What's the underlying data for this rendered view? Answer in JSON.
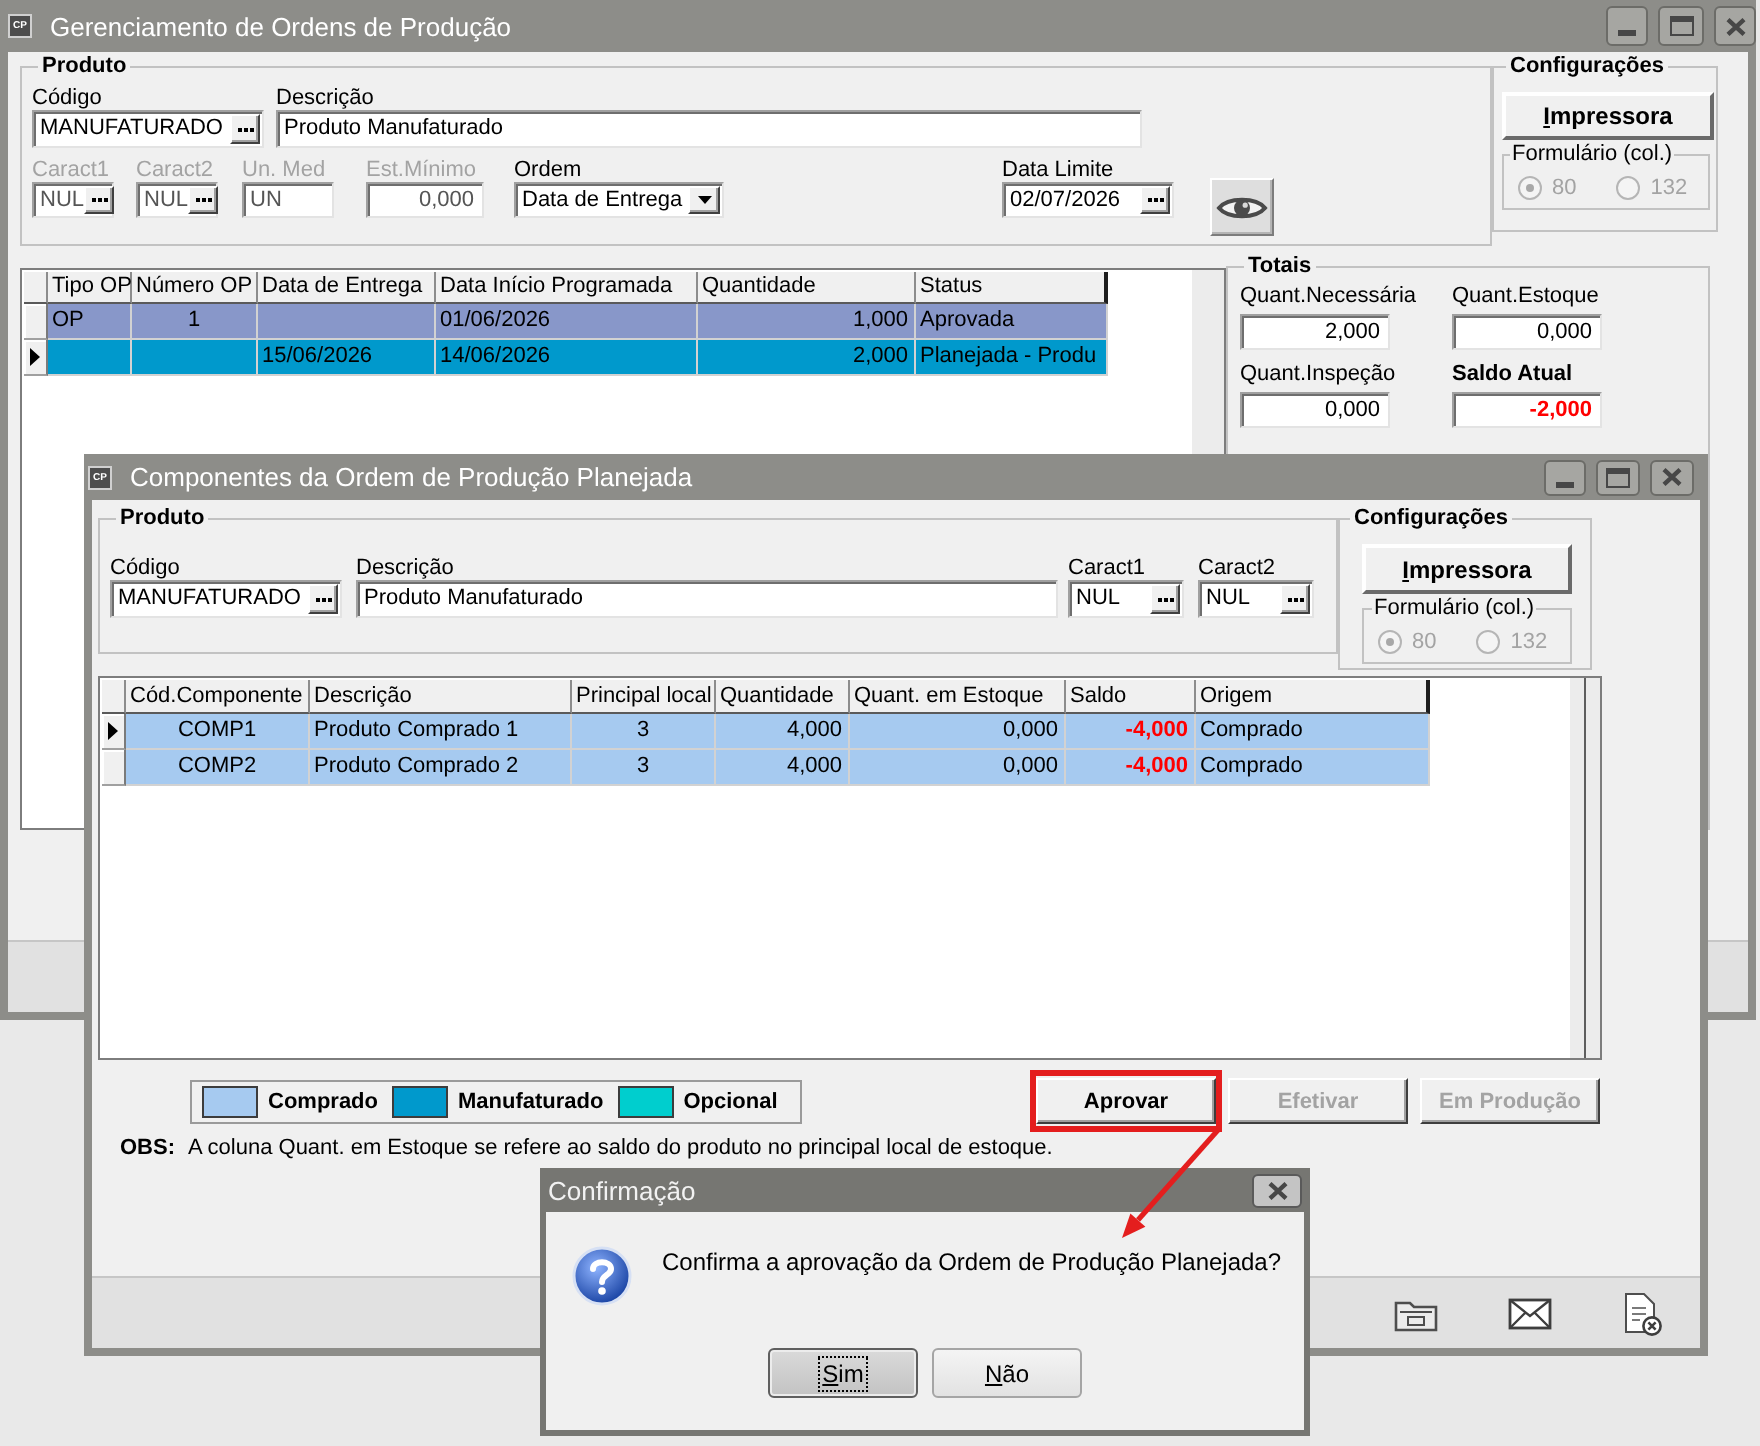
{
  "main_window": {
    "icon_text": "CP",
    "title": "Gerenciamento de Ordens de Produção",
    "product_group": {
      "title": "Produto",
      "field_rows": [
        [
          {
            "kind": "lookup",
            "label": "Código",
            "value": "MANUFATURADO",
            "disabled": false
          },
          {
            "kind": "text",
            "label": "Descrição",
            "value": "Produto Manufaturado",
            "disabled": false
          }
        ],
        [
          {
            "kind": "lookup",
            "label": "Caract1",
            "value": "NUL",
            "disabled": true
          },
          {
            "kind": "lookup",
            "label": "Caract2",
            "value": "NUL",
            "disabled": true
          },
          {
            "kind": "text",
            "label": "Un. Med",
            "value": "UN",
            "disabled": true
          },
          {
            "kind": "number",
            "label": "Est.Mínimo",
            "value": "0,000",
            "disabled": true
          },
          {
            "kind": "dropdown",
            "label": "Ordem",
            "value": "Data de Entrega",
            "disabled": false
          },
          {
            "kind": "lookup",
            "label": "Data Limite",
            "value": "02/07/2026",
            "disabled": false
          }
        ]
      ]
    },
    "settings_group": {
      "title": "Configurações",
      "button": "Impressora",
      "form_group": {
        "title": "Formulário (col.)",
        "disabled": true,
        "options": [
          {
            "label": "80",
            "selected": true
          },
          {
            "label": "132",
            "selected": false
          }
        ]
      }
    },
    "orders_table": {
      "columns": [
        {
          "label": "Tipo OP",
          "kind": "text"
        },
        {
          "label": "Número OP",
          "kind": "center"
        },
        {
          "label": "Data de Entrega",
          "kind": "text"
        },
        {
          "label": "Data Início Programada",
          "kind": "text"
        },
        {
          "label": "Quantidade",
          "kind": "number"
        },
        {
          "label": "Status",
          "kind": "text"
        }
      ],
      "rows": [
        {
          "selected": false,
          "color": "#8897c9",
          "cells": [
            "OP",
            "1",
            null,
            "01/06/2026",
            "1,000",
            "Aprovada"
          ]
        },
        {
          "selected": true,
          "color": "#0099cc",
          "cells": [
            null,
            null,
            "15/06/2026",
            "14/06/2026",
            "2,000",
            "Planejada - Produ"
          ]
        }
      ]
    },
    "totals_group": {
      "title": "Totais",
      "fields": [
        {
          "kind": "quantity",
          "label": "Quant.Necessária",
          "value": "2,000"
        },
        {
          "kind": "quantity",
          "label": "Quant.Estoque",
          "value": "0,000"
        },
        {
          "kind": "quantity",
          "label": "Quant.Inspeção",
          "value": "0,000"
        },
        {
          "kind": "balance",
          "label": "Saldo Atual",
          "value": "-2,000"
        }
      ]
    }
  },
  "components_window": {
    "icon_text": "CP",
    "title": "Componentes da Ordem de Produção Planejada",
    "product_group": {
      "title": "Produto",
      "field_rows": [
        [
          {
            "kind": "lookup",
            "label": "Código",
            "value": "MANUFATURADO",
            "disabled": false
          },
          {
            "kind": "text",
            "label": "Descrição",
            "value": "Produto Manufaturado",
            "disabled": false
          },
          {
            "kind": "lookup",
            "label": "Caract1",
            "value": "NUL",
            "disabled": false
          },
          {
            "kind": "lookup",
            "label": "Caract2",
            "value": "NUL",
            "disabled": false
          }
        ]
      ]
    },
    "settings_group": {
      "title": "Configurações",
      "button": "Impressora",
      "form_group": {
        "title": "Formulário (col.)",
        "disabled": true,
        "options": [
          {
            "label": "80",
            "selected": true
          },
          {
            "label": "132",
            "selected": false
          }
        ]
      }
    },
    "components_table": {
      "columns": [
        {
          "label": "Cód.Componente",
          "kind": "center"
        },
        {
          "label": "Descrição",
          "kind": "text"
        },
        {
          "label": "Principal local",
          "kind": "center"
        },
        {
          "label": "Quantidade",
          "kind": "number"
        },
        {
          "label": "Quant. em Estoque",
          "kind": "number"
        },
        {
          "label": "Saldo",
          "kind": "balance"
        },
        {
          "label": "Origem",
          "kind": "text"
        }
      ],
      "rows": [
        {
          "selected": true,
          "color": "#a6caf0",
          "cells": [
            "COMP1",
            "Produto Comprado 1",
            "3",
            "4,000",
            "0,000",
            "-4,000",
            "Comprado"
          ]
        },
        {
          "selected": false,
          "color": "#a6caf0",
          "cells": [
            "COMP2",
            "Produto Comprado 2",
            "3",
            "4,000",
            "0,000",
            "-4,000",
            "Comprado"
          ]
        }
      ]
    },
    "legend": [
      {
        "label": "Comprado",
        "color": "#a6caf0"
      },
      {
        "label": "Manufaturado",
        "color": "#0099cc"
      },
      {
        "label": "Opcional",
        "color": "#00cece"
      }
    ],
    "actions": [
      {
        "label": "Aprovar",
        "disabled": false,
        "highlighted": true
      },
      {
        "label": "Efetivar",
        "disabled": true,
        "highlighted": false
      },
      {
        "label": "Em Produção",
        "disabled": true,
        "highlighted": false
      }
    ],
    "note": {
      "label": "OBS:",
      "text": "A coluna Quant. em Estoque se refere ao saldo do produto no principal local de estoque."
    }
  },
  "dialog": {
    "title": "Confirmação",
    "message": "Confirma a aprovação da Ordem de Produção Planejada?",
    "buttons": [
      {
        "label": "Sim",
        "focused": true
      },
      {
        "label": "Não",
        "focused": false
      }
    ]
  }
}
